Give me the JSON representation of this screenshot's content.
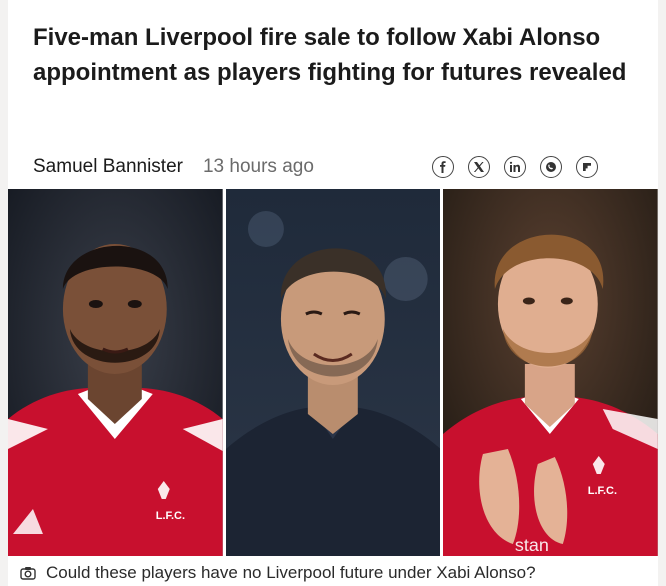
{
  "article": {
    "headline": "Five-man Liverpool fire sale to follow Xabi Alonso appointment as players fighting for futures revealed",
    "author": "Samuel Bannister",
    "timestamp": "13 hours ago",
    "caption": "Could these players have no Liverpool future under Xabi Alonso?"
  },
  "share": [
    {
      "name": "facebook-icon",
      "glyph": "f"
    },
    {
      "name": "x-icon",
      "glyph": "𝕏"
    },
    {
      "name": "linkedin-icon",
      "glyph": "in"
    },
    {
      "name": "whatsapp-icon",
      "glyph": "✆"
    },
    {
      "name": "flipboard-icon",
      "glyph": "F"
    }
  ],
  "hero": {
    "panels": [
      {
        "subject": "player-left",
        "crest_text": "L.F.C."
      },
      {
        "subject": "manager-center"
      },
      {
        "subject": "player-right",
        "crest_text": "L.F.C.",
        "sponsor_text": "stan"
      }
    ]
  },
  "colors": {
    "kit_red": "#c8102e",
    "background": "#ffffff",
    "page_bg": "#f3f2f1"
  }
}
